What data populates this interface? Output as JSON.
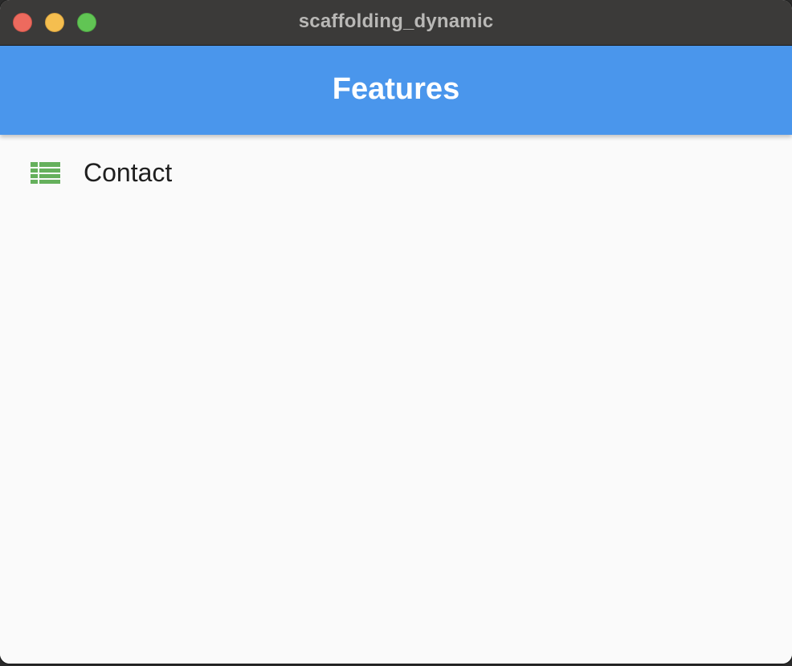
{
  "window": {
    "title": "scaffolding_dynamic",
    "controls": [
      "close",
      "minimize",
      "zoom"
    ]
  },
  "appbar": {
    "title": "Features",
    "color": "#4a96ec"
  },
  "list": {
    "items": [
      {
        "label": "Contact",
        "icon": "table-rows-icon",
        "icon_color": "#65b05c"
      }
    ]
  }
}
